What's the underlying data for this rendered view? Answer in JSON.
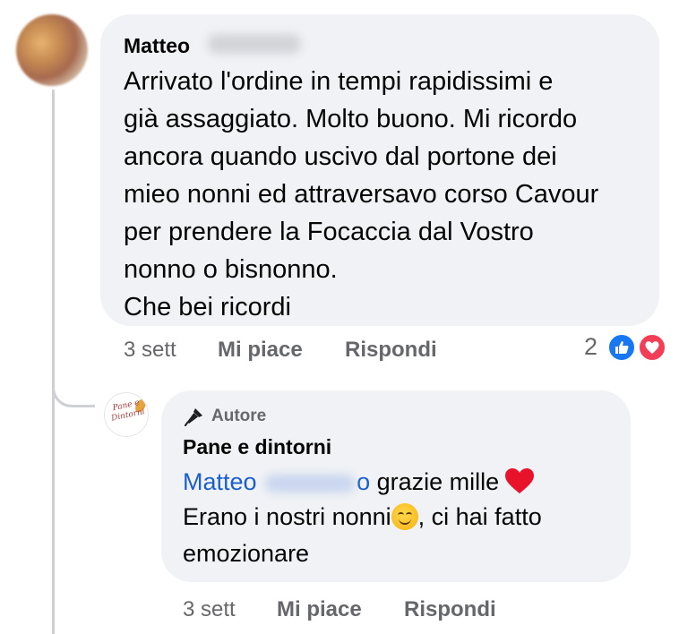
{
  "comment": {
    "author": "Matteo",
    "author_surname_redacted": "M█████",
    "text": "Arrivato l'ordine in tempi rapidissimi e\ngià assaggiato. Molto buono. Mi ricordo\nancora quando uscivo dal portone dei\nmieo nonni ed attraversavo corso Cavour\nper prendere la Focaccia dal Vostro\nnonno o bisnonno.\nChe bei ricordi",
    "time": "3 sett",
    "like_label": "Mi piace",
    "reply_label": "Rispondi",
    "reaction_count": "2",
    "reactions": [
      "like-icon",
      "love-icon"
    ]
  },
  "reply": {
    "badge": "Autore",
    "badge_icon": "microphone-icon",
    "page_name": "Pane e dintorni",
    "avatar_logo_text": "Pane e Dintorni",
    "mention_first": "Matteo",
    "mention_last": "o",
    "line1_rest": "grazie mille",
    "line2": "Erano i nostri nonni",
    "line2_rest": ", ci hai fatto",
    "line3": "emozionare",
    "emoji": [
      "heart-emoji",
      "smile-emoji"
    ],
    "time": "3 sett",
    "like_label": "Mi piace",
    "reply_label": "Rispondi"
  },
  "colors": {
    "bubble": "#f0f2f5",
    "mention": "#1b5fcc",
    "meta": "#65676b",
    "like": "#1877f2",
    "love": "#f33e58"
  }
}
